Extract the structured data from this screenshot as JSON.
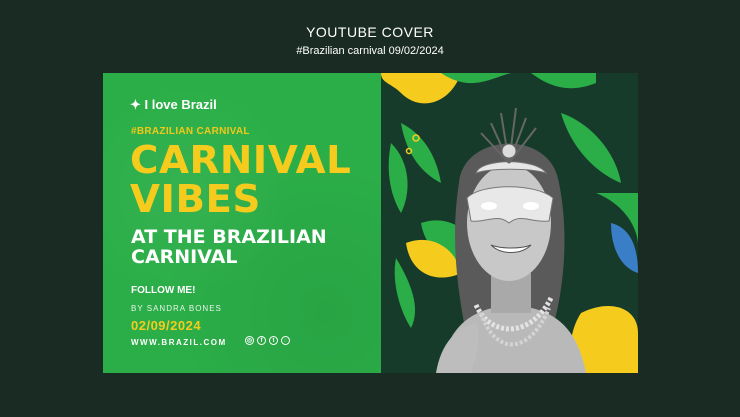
{
  "header": {
    "title": "YOUTUBE COVER",
    "subtitle": "#Brazilian carnival 09/02/2024"
  },
  "banner": {
    "love_text": "I love Brazil",
    "hashtag": "#BRAZILIAN CARNIVAL",
    "headline_line1": "CARNIVAL",
    "headline_line2": "VIBES",
    "sub_line1": "AT THE BRAZILIAN",
    "sub_line2": "CARNIVAL",
    "follow": "FOLLOW ME!",
    "author": "BY SANDRA BONES",
    "date": "02/09/2024",
    "website": "WWW.BRAZIL.COM",
    "social_icons": [
      "instagram-icon",
      "facebook-icon",
      "twitter-icon",
      "whatsapp-icon"
    ]
  },
  "colors": {
    "background": "#1a2b24",
    "green": "#2bae48",
    "yellow": "#f5cc1e",
    "dark_green": "#163b2a"
  }
}
